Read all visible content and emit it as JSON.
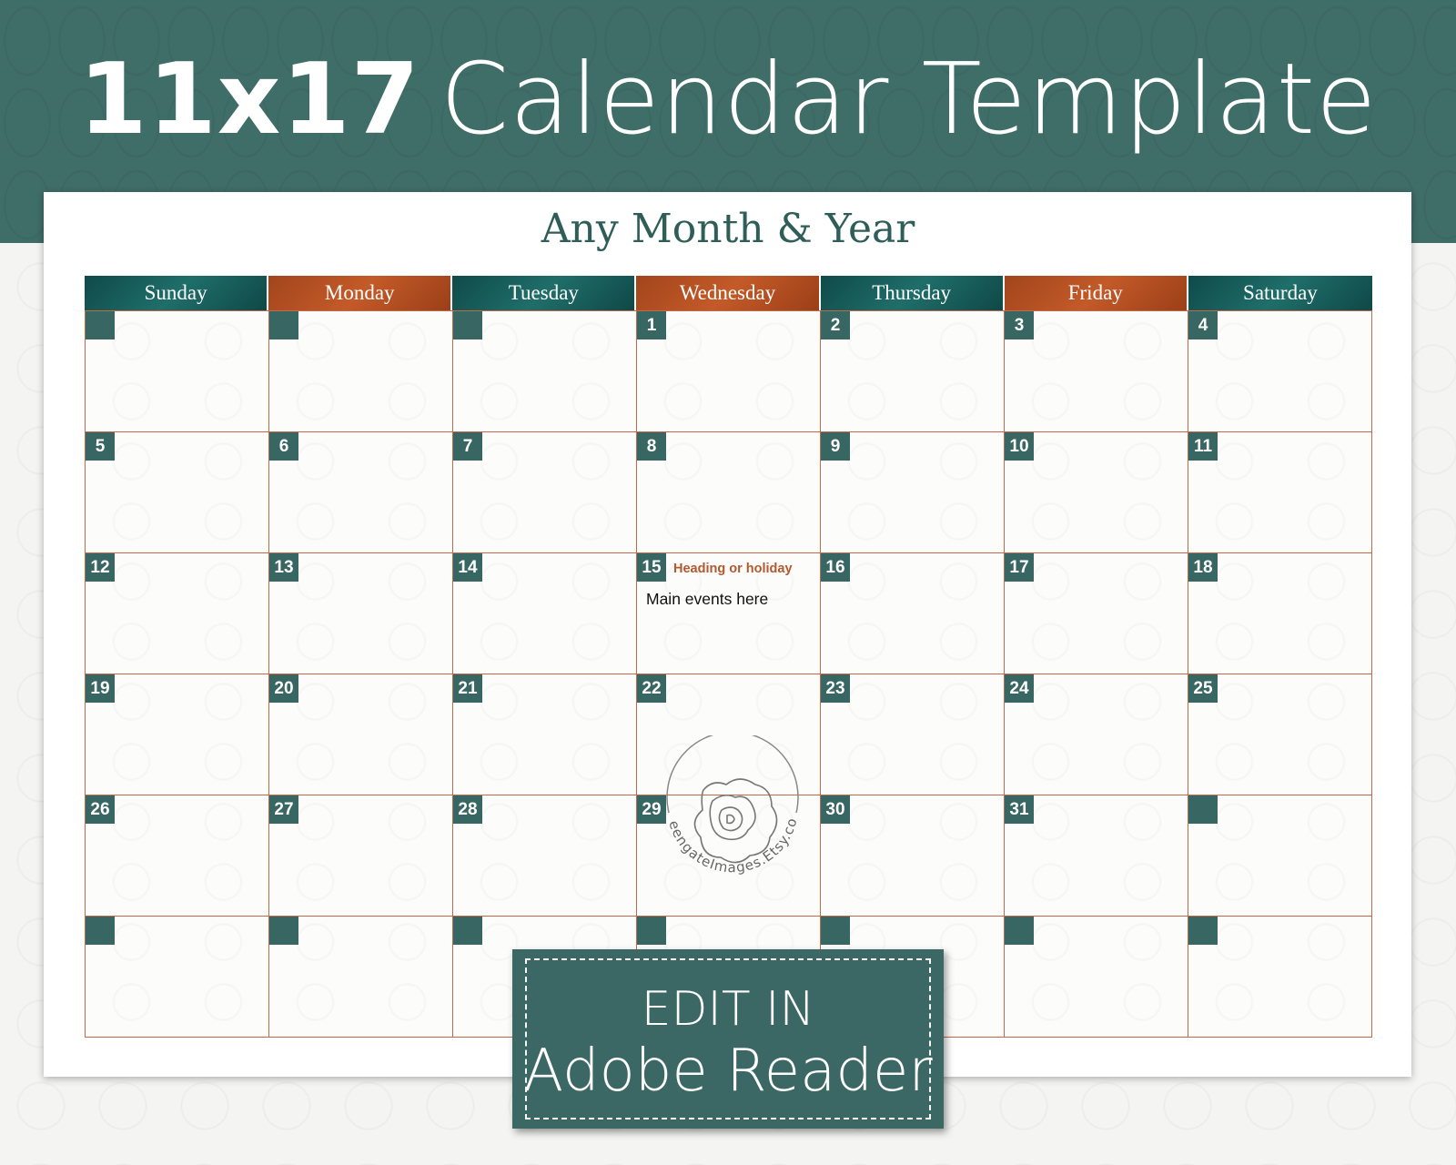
{
  "banner": {
    "title_bold": "11x17",
    "title_rest": "Calendar Template"
  },
  "calendar": {
    "month_title": "Any Month & Year",
    "days": [
      {
        "label": "Sunday",
        "style": "teal"
      },
      {
        "label": "Monday",
        "style": "rust"
      },
      {
        "label": "Tuesday",
        "style": "teal"
      },
      {
        "label": "Wednesday",
        "style": "rust"
      },
      {
        "label": "Thursday",
        "style": "teal"
      },
      {
        "label": "Friday",
        "style": "rust"
      },
      {
        "label": "Saturday",
        "style": "teal"
      }
    ],
    "weeks": [
      [
        "",
        "",
        "",
        "1",
        "2",
        "3",
        "4"
      ],
      [
        "5",
        "6",
        "7",
        "8",
        "9",
        "10",
        "11"
      ],
      [
        "12",
        "13",
        "14",
        "15",
        "16",
        "17",
        "18"
      ],
      [
        "19",
        "20",
        "21",
        "22",
        "23",
        "24",
        "25"
      ],
      [
        "26",
        "27",
        "28",
        "29",
        "30",
        "31",
        ""
      ],
      [
        "",
        "",
        "",
        "",
        "",
        "",
        ""
      ]
    ],
    "sample_cell": {
      "date": "15",
      "heading": "Heading or holiday",
      "events": "Main events here"
    }
  },
  "watermark": {
    "text": "GreengateImages.Etsy.com"
  },
  "badge": {
    "line1": "EDIT IN",
    "line2": "Adobe Reader"
  },
  "colors": {
    "teal": "#3b6864",
    "rust": "#c2694a",
    "heading": "#b15a30",
    "title": "#2f5e58"
  }
}
